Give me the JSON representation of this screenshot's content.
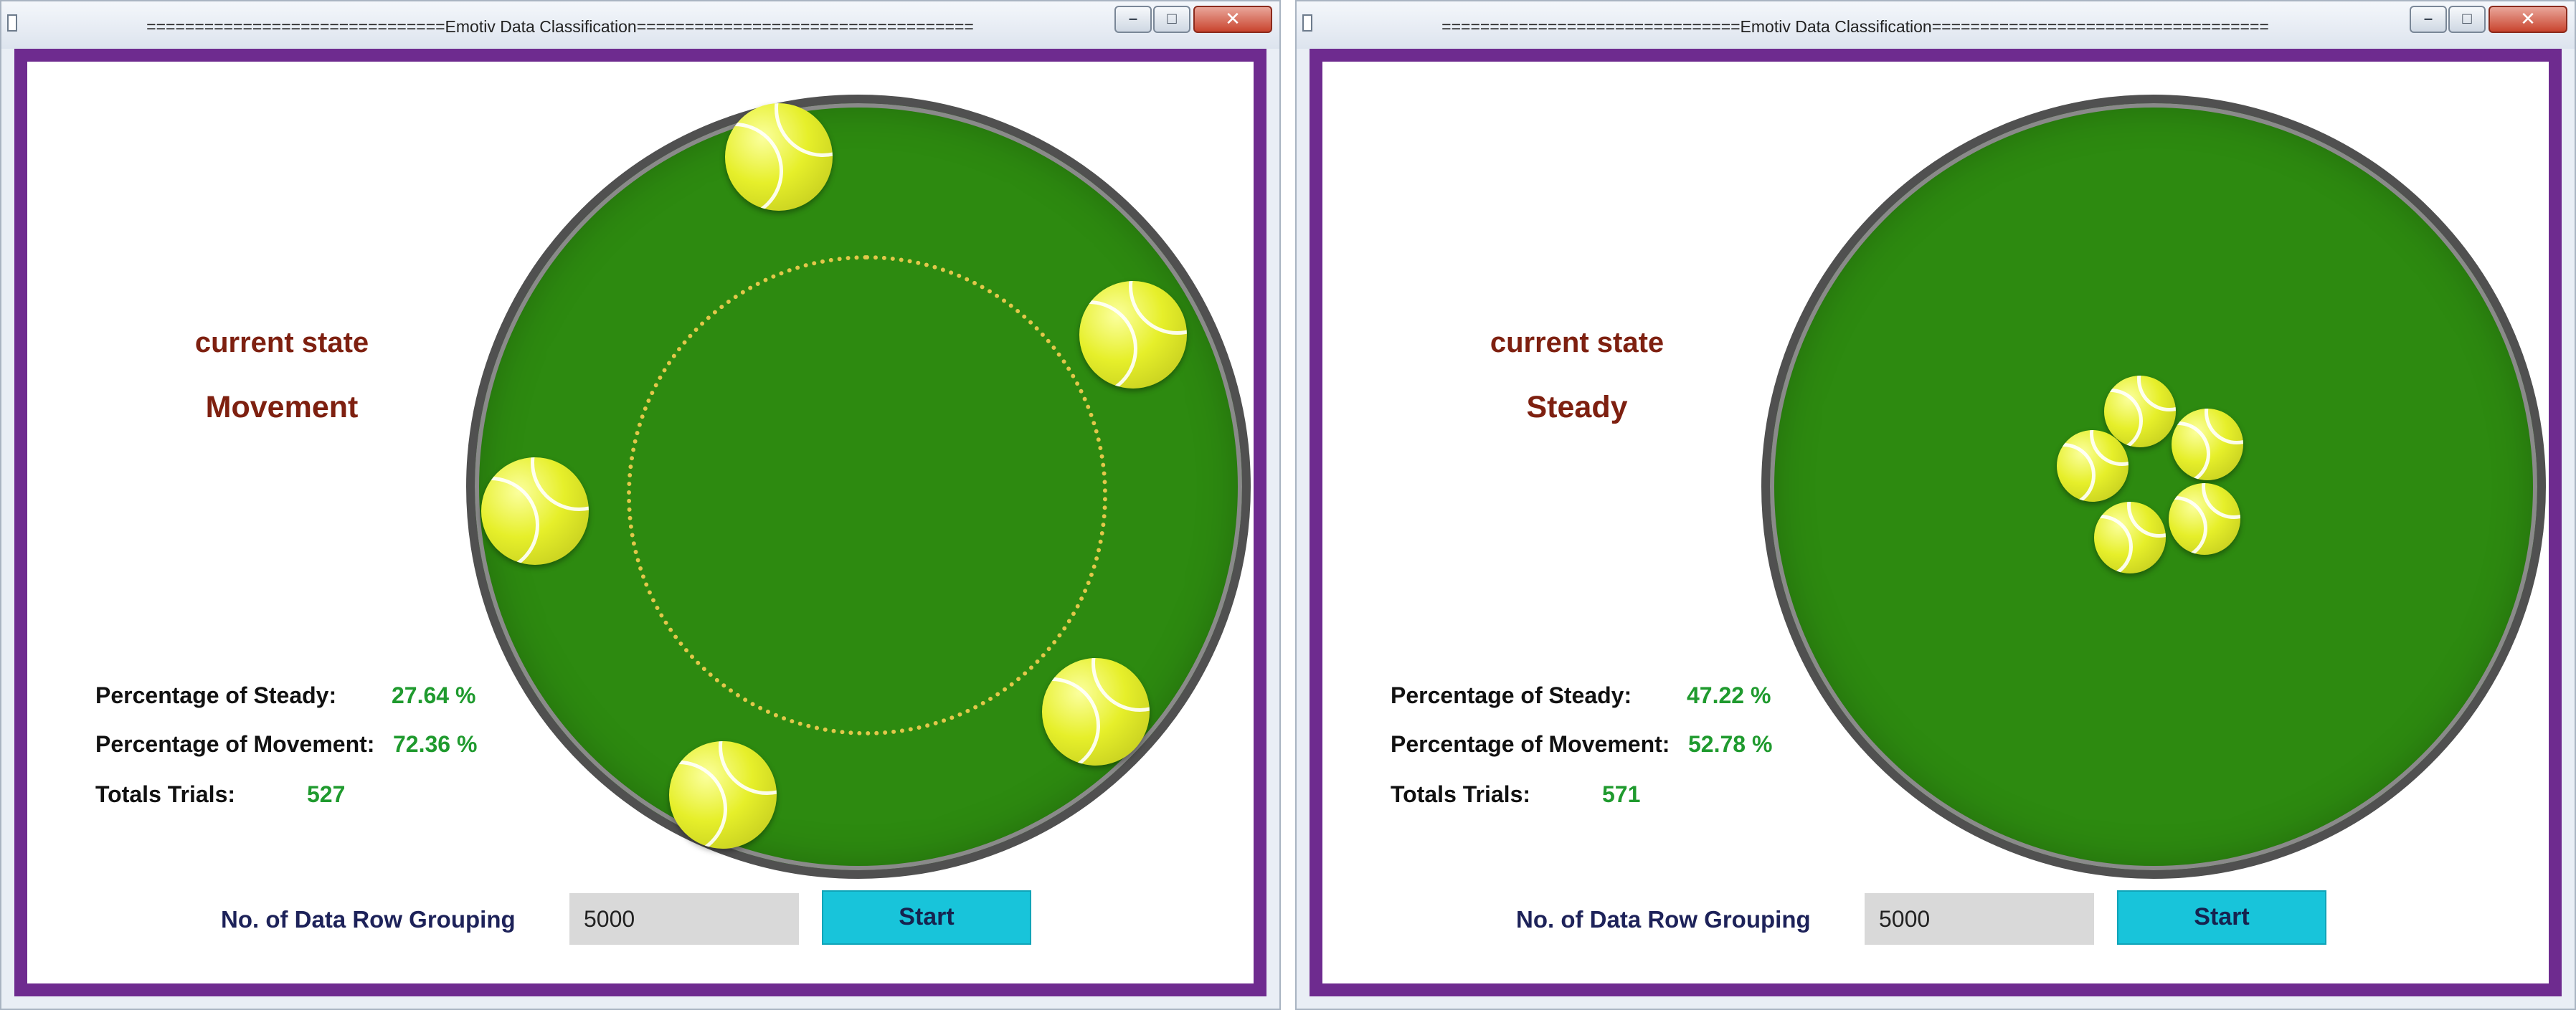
{
  "windows": [
    {
      "title": "===============================Emotiv Data Classification===================================",
      "window_controls": {
        "minimize": "–",
        "maximize": "□",
        "close": "✕"
      },
      "current_state_label": "current state",
      "current_state": "Movement",
      "stats": {
        "steady_label": "Percentage of Steady:",
        "steady_value": "27.64 %",
        "movement_label": "Percentage of Movement:",
        "movement_value": "72.36 %",
        "trials_label": "Totals Trials:",
        "trials_value": "527"
      },
      "grouping": {
        "label": "No. of Data Row Grouping",
        "value": "5000"
      },
      "start_label": "Start",
      "ball_formation": "spread-on-dotted-circle",
      "ball_count": 5
    },
    {
      "title": "===============================Emotiv Data Classification===================================",
      "window_controls": {
        "minimize": "–",
        "maximize": "□",
        "close": "✕"
      },
      "current_state_label": "current state",
      "current_state": "Steady",
      "stats": {
        "steady_label": "Percentage of Steady:",
        "steady_value": "47.22 %",
        "movement_label": "Percentage of Movement:",
        "movement_value": "52.78 %",
        "trials_label": "Totals Trials:",
        "trials_value": "571"
      },
      "grouping": {
        "label": "No. of Data Row Grouping",
        "value": "5000"
      },
      "start_label": "Start",
      "ball_formation": "clustered-ring",
      "ball_count": 5
    }
  ],
  "icons": [
    "app-icon",
    "minimize-icon",
    "maximize-icon",
    "close-icon",
    "tennis-ball-icon"
  ],
  "colors": {
    "frame_border": "#6e2b8f",
    "field_green": "#2d8a10",
    "state_text": "#7e2010",
    "value_green": "#1f9a2e",
    "start_button": "#18c4da",
    "label_navy": "#1d2259"
  }
}
